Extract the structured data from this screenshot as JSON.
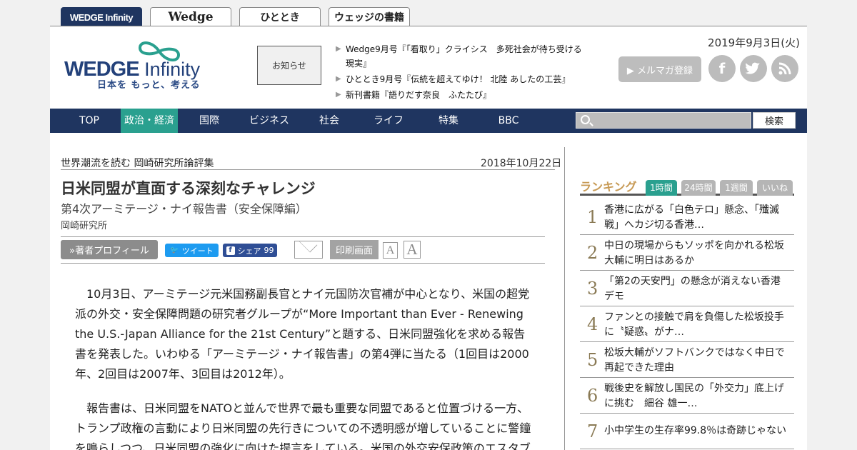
{
  "site_tabs": [
    {
      "label": "WEDGE Infinity"
    },
    {
      "label": "Wedge"
    },
    {
      "label": "ひととき"
    },
    {
      "label": "ウェッジの書籍"
    }
  ],
  "header": {
    "logo_text": "WEDGE",
    "logo_text_2": " Infinity",
    "logo_tagline": "日本を もっと、考える",
    "news_label": "お知らせ",
    "news": [
      "Wedge9月号『「看取り」クライシス　多死社会が待ち受ける現実』",
      "ひととき9月号『伝統を超えてゆけ！ 北陸 あしたの工芸』",
      "新刊書籍『語りだす奈良　ふたたび』"
    ],
    "date": "2019年9月3日(火)",
    "mail_button": "▶ メルマガ登録",
    "social": {
      "facebook": "f",
      "twitter_icon": "twitter-bird",
      "rss_icon": "rss"
    }
  },
  "nav": {
    "items": [
      "TOP",
      "政治・経済",
      "国際",
      "ビジネス",
      "社会",
      "ライフ",
      "特集",
      "BBC"
    ],
    "active": "政治・経済",
    "search_placeholder": "",
    "search_button": "検索"
  },
  "article": {
    "series": "世界潮流を読む 岡崎研究所論評集",
    "date": "2018年10月22日",
    "title": "日米同盟が直面する深刻なチャレンジ",
    "subtitle": "第4次アーミテージ・ナイ報告書（安全保障編）",
    "author": "岡崎研究所",
    "profile_button": "»著者プロフィール",
    "tweet_button": "ツイート",
    "share_button": "シェア",
    "share_count": "99",
    "print_button": "印刷画面",
    "font_small": "A",
    "font_large": "A",
    "paragraphs": [
      "10月3日、アーミテージ元米国務副長官とナイ元国防次官補が中心となり、米国の超党派の外交・安全保障問題の研究者グループが“More Important than Ever - Renewing the U.S.-Japan Alliance for the 21st Century”と題する、日米同盟強化を求める報告書を発表した。いわゆる「アーミテージ・ナイ報告書」の第4弾に当たる（1回目は2000年、2回目は2007年、3回目は2012年）。",
      "報告書は、日米同盟をNATOと並んで世界で最も重要な同盟であると位置づける一方、トランプ政権の言動により日米同盟の先行きについての不透明感が増していることに警鐘を鳴らしつつ、日米同盟の強化に向けた提言をしている。米国の外交安保政策のエスタブ"
    ]
  },
  "ranking": {
    "title": "ランキング",
    "tabs": [
      "1時間",
      "24時間",
      "1週間",
      "いいね"
    ],
    "active_tab": "1時間",
    "items": [
      {
        "rank": "1",
        "text": "香港に広がる「白色テロ」懸念、「殲滅戦」へカジ切る香港…"
      },
      {
        "rank": "2",
        "text": "中日の現場からもソッポを向かれる松坂大輔に明日はあるか"
      },
      {
        "rank": "3",
        "text": "「第2の天安門」の懸念が消えない香港デモ"
      },
      {
        "rank": "4",
        "text": "ファンとの接触で肩を負傷した松坂投手に〝疑惑〟がナ…"
      },
      {
        "rank": "5",
        "text": "松坂大輔がソフトバンクではなく中日で再起できた理由"
      },
      {
        "rank": "6",
        "text": "戦後史を解放し国民の「外交力」底上げに挑む　細谷 雄一…"
      },
      {
        "rank": "7",
        "text": "小中学生の生存率99.8％は奇跡じゃない"
      }
    ]
  }
}
